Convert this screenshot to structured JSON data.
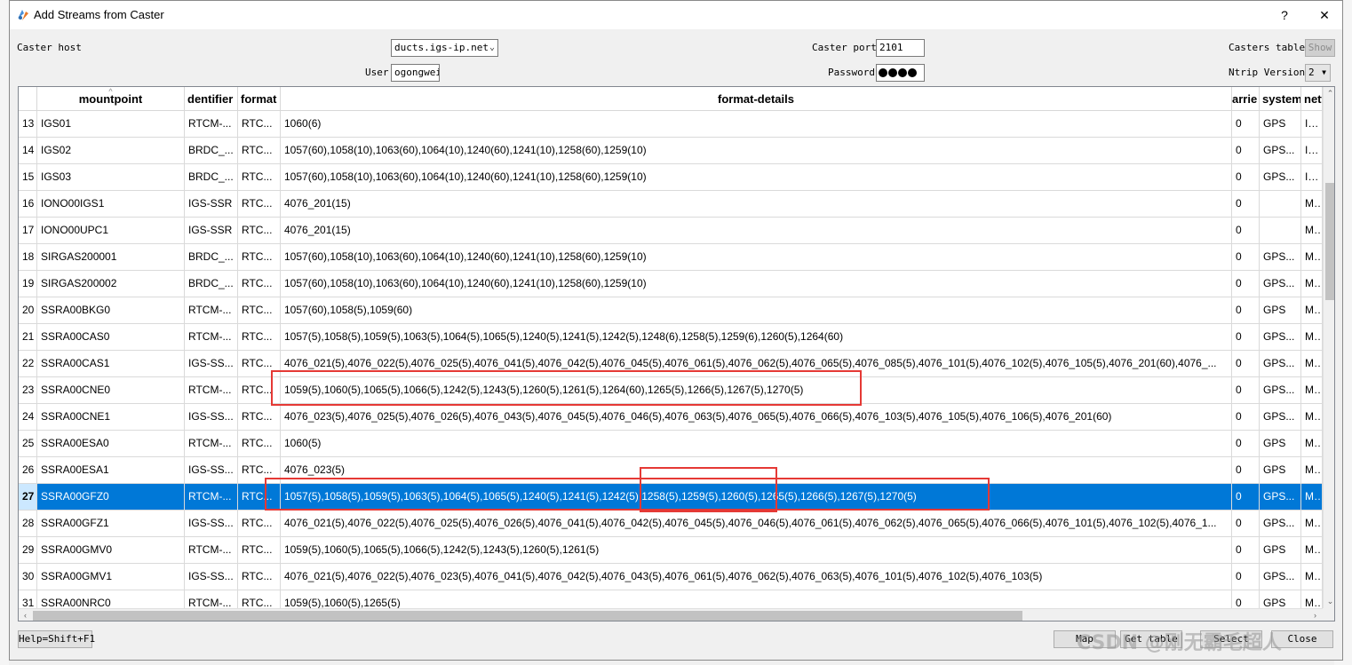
{
  "window": {
    "title": "Add Streams from Caster",
    "help_glyph": "?",
    "close_glyph": "✕"
  },
  "form": {
    "caster_host_label": "Caster host",
    "caster_host_value": "ducts.igs-ip.net",
    "caster_port_label": "Caster port",
    "caster_port_value": "2101",
    "casters_table_label": "Casters table",
    "show_button": "Show",
    "user_label": "User",
    "user_value": "ogongwei",
    "password_label": "Password",
    "ntrip_version_label": "Ntrip Version",
    "ntrip_version_value": "2"
  },
  "table": {
    "headers": [
      "mountpoint",
      "identifier",
      "format",
      "format-details",
      "carrier",
      "system",
      "network"
    ],
    "headers_shown": [
      "mountpoint",
      "dentifier",
      "format",
      "format-details",
      "arrie",
      "system",
      "netw"
    ],
    "rows": [
      {
        "num": "13",
        "mountpoint": "IGS01",
        "identifier": "RTCM-...",
        "format": "RTC...",
        "details": "1060(6)",
        "carrier": "0",
        "system": "GPS",
        "network": "IGS"
      },
      {
        "num": "14",
        "mountpoint": "IGS02",
        "identifier": "BRDC_...",
        "format": "RTC...",
        "details": "1057(60),1058(10),1063(60),1064(10),1240(60),1241(10),1258(60),1259(10)",
        "carrier": "0",
        "system": "GPS...",
        "network": "IGS"
      },
      {
        "num": "15",
        "mountpoint": "IGS03",
        "identifier": "BRDC_...",
        "format": "RTC...",
        "details": "1057(60),1058(10),1063(60),1064(10),1240(60),1241(10),1258(60),1259(10)",
        "carrier": "0",
        "system": "GPS...",
        "network": "IGS"
      },
      {
        "num": "16",
        "mountpoint": "IONO00IGS1",
        "identifier": "IGS-SSR",
        "format": "RTC...",
        "details": "4076_201(15)",
        "carrier": "0",
        "system": "",
        "network": "MIS"
      },
      {
        "num": "17",
        "mountpoint": "IONO00UPC1",
        "identifier": "IGS-SSR",
        "format": "RTC...",
        "details": "4076_201(15)",
        "carrier": "0",
        "system": "",
        "network": "MIS"
      },
      {
        "num": "18",
        "mountpoint": "SIRGAS200001",
        "identifier": "BRDC_...",
        "format": "RTC...",
        "details": "1057(60),1058(10),1063(60),1064(10),1240(60),1241(10),1258(60),1259(10)",
        "carrier": "0",
        "system": "GPS...",
        "network": "MIS"
      },
      {
        "num": "19",
        "mountpoint": "SIRGAS200002",
        "identifier": "BRDC_...",
        "format": "RTC...",
        "details": "1057(60),1058(10),1063(60),1064(10),1240(60),1241(10),1258(60),1259(10)",
        "carrier": "0",
        "system": "GPS...",
        "network": "MIS"
      },
      {
        "num": "20",
        "mountpoint": "SSRA00BKG0",
        "identifier": "RTCM-...",
        "format": "RTC...",
        "details": "1057(60),1058(5),1059(60)",
        "carrier": "0",
        "system": "GPS",
        "network": "MIS"
      },
      {
        "num": "21",
        "mountpoint": "SSRA00CAS0",
        "identifier": "RTCM-...",
        "format": "RTC...",
        "details": "1057(5),1058(5),1059(5),1063(5),1064(5),1065(5),1240(5),1241(5),1242(5),1248(6),1258(5),1259(6),1260(5),1264(60)",
        "carrier": "0",
        "system": "GPS...",
        "network": "MIS"
      },
      {
        "num": "22",
        "mountpoint": "SSRA00CAS1",
        "identifier": "IGS-SS...",
        "format": "RTC...",
        "details": "4076_021(5),4076_022(5),4076_025(5),4076_041(5),4076_042(5),4076_045(5),4076_061(5),4076_062(5),4076_065(5),4076_085(5),4076_101(5),4076_102(5),4076_105(5),4076_201(60),4076_...",
        "carrier": "0",
        "system": "GPS...",
        "network": "MIS"
      },
      {
        "num": "23",
        "mountpoint": "SSRA00CNE0",
        "identifier": "RTCM-...",
        "format": "RTC...",
        "details": "1059(5),1060(5),1065(5),1066(5),1242(5),1243(5),1260(5),1261(5),1264(60),1265(5),1266(5),1267(5),1270(5)",
        "carrier": "0",
        "system": "GPS...",
        "network": "MIS"
      },
      {
        "num": "24",
        "mountpoint": "SSRA00CNE1",
        "identifier": "IGS-SS...",
        "format": "RTC...",
        "details": "4076_023(5),4076_025(5),4076_026(5),4076_043(5),4076_045(5),4076_046(5),4076_063(5),4076_065(5),4076_066(5),4076_103(5),4076_105(5),4076_106(5),4076_201(60)",
        "carrier": "0",
        "system": "GPS...",
        "network": "MIS"
      },
      {
        "num": "25",
        "mountpoint": "SSRA00ESA0",
        "identifier": "RTCM-...",
        "format": "RTC...",
        "details": "1060(5)",
        "carrier": "0",
        "system": "GPS",
        "network": "MIS"
      },
      {
        "num": "26",
        "mountpoint": "SSRA00ESA1",
        "identifier": "IGS-SS...",
        "format": "RTC...",
        "details": "4076_023(5)",
        "carrier": "0",
        "system": "GPS",
        "network": "MIS"
      },
      {
        "num": "27",
        "mountpoint": "SSRA00GFZ0",
        "identifier": "RTCM-...",
        "format": "RTC...",
        "details": "1057(5),1058(5),1059(5),1063(5),1064(5),1065(5),1240(5),1241(5),1242(5),1258(5),1259(5),1260(5),1265(5),1266(5),1267(5),1270(5)",
        "carrier": "0",
        "system": "GPS...",
        "network": "MIS",
        "selected": true
      },
      {
        "num": "28",
        "mountpoint": "SSRA00GFZ1",
        "identifier": "IGS-SS...",
        "format": "RTC...",
        "details": "4076_021(5),4076_022(5),4076_025(5),4076_026(5),4076_041(5),4076_042(5),4076_045(5),4076_046(5),4076_061(5),4076_062(5),4076_065(5),4076_066(5),4076_101(5),4076_102(5),4076_1...",
        "carrier": "0",
        "system": "GPS...",
        "network": "MIS"
      },
      {
        "num": "29",
        "mountpoint": "SSRA00GMV0",
        "identifier": "RTCM-...",
        "format": "RTC...",
        "details": "1059(5),1060(5),1065(5),1066(5),1242(5),1243(5),1260(5),1261(5)",
        "carrier": "0",
        "system": "GPS",
        "network": "MIS"
      },
      {
        "num": "30",
        "mountpoint": "SSRA00GMV1",
        "identifier": "IGS-SS...",
        "format": "RTC...",
        "details": "4076_021(5),4076_022(5),4076_023(5),4076_041(5),4076_042(5),4076_043(5),4076_061(5),4076_062(5),4076_063(5),4076_101(5),4076_102(5),4076_103(5)",
        "carrier": "0",
        "system": "GPS...",
        "network": "MIS"
      },
      {
        "num": "31",
        "mountpoint": "SSRA00NRC0",
        "identifier": "RTCM-...",
        "format": "RTC...",
        "details": "1059(5),1060(5),1265(5)",
        "carrier": "0",
        "system": "GPS",
        "network": "MIS"
      }
    ]
  },
  "footer": {
    "help_button": "Help=Shift+F1",
    "map_button": "Map",
    "get_table_button": "Get table",
    "select_button": "Select",
    "close_button": "Close",
    "watermark": "CSDN @刚无霸毛超人"
  },
  "colors": {
    "selection": "#0078d7",
    "annotation_box": "#e53935"
  }
}
